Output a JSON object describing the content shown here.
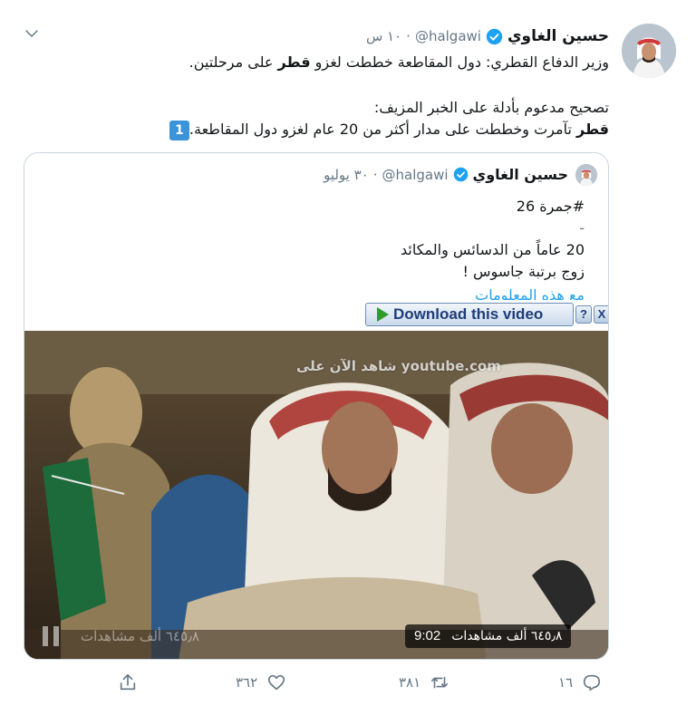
{
  "tweet": {
    "author_name": "حسين الغاوي",
    "handle": "@halgawi",
    "separator": "·",
    "time": "١٠ س",
    "line1_pre": "وزير الدفاع القطري: دول المقاطعة خططت لغزو ",
    "line1_bold": "قطر",
    "line1_post": " على مرحلتين.",
    "line2": "تصحيح مدعوم بأدلة على الخبر المزيف:",
    "line3_bold": "قطر",
    "line3_post": " تآمرت وخططت على مدار أكثر من 20 عام لغزو دول المقاطعة.",
    "keycap": "1"
  },
  "quote": {
    "author_name": "حسين الغاوي",
    "handle": "@halgawi",
    "separator": "·",
    "date": "٣٠ يوليو",
    "line1": "#جمرة 26",
    "line2": "-",
    "line3": "20 عاماً من الدسائس والمكائد",
    "line4": "زوج برتبة جاسوس !",
    "line5": "مع هذه المعلومات"
  },
  "download_bar": {
    "label": "Download this video",
    "help": "?",
    "close": "X"
  },
  "video": {
    "watermark": "شاهد الآن على youtube.com",
    "views_faint": "٦٤٥٫٨ ألف مشاهدات",
    "views": "٦٤٥٫٨ ألف مشاهدات",
    "duration": "9:02"
  },
  "actions": {
    "reply_count": "١٦",
    "retweet_count": "٣٨١",
    "like_count": "٣٦٢",
    "share_count": ""
  },
  "colors": {
    "verified": "#1da1f2",
    "secondary_text": "#657786",
    "border": "#ccd6dd"
  }
}
